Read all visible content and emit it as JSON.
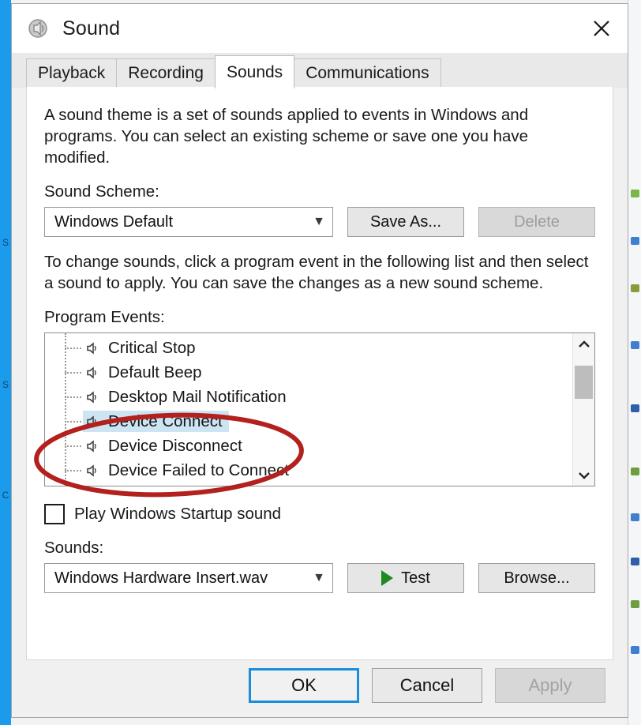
{
  "window": {
    "title": "Sound",
    "icon": "speaker-icon",
    "close_label": "✕"
  },
  "tabs": [
    {
      "label": "Playback",
      "active": false
    },
    {
      "label": "Recording",
      "active": false
    },
    {
      "label": "Sounds",
      "active": true
    },
    {
      "label": "Communications",
      "active": false
    }
  ],
  "sounds_tab": {
    "intro_text": "A sound theme is a set of sounds applied to events in Windows and programs.  You can select an existing scheme or save one you have modified.",
    "scheme_label": "Sound Scheme:",
    "scheme_value": "Windows Default",
    "save_as_label": "Save As...",
    "delete_label": "Delete",
    "delete_disabled": true,
    "instructions_text": "To change sounds, click a program event in the following list and then select a sound to apply.  You can save the changes as a new sound scheme.",
    "program_events_label": "Program Events:",
    "events": [
      {
        "label": "Critical Stop",
        "selected": false
      },
      {
        "label": "Default Beep",
        "selected": false
      },
      {
        "label": "Desktop Mail Notification",
        "selected": false
      },
      {
        "label": "Device Connect",
        "selected": true
      },
      {
        "label": "Device Disconnect",
        "selected": false
      },
      {
        "label": "Device Failed to Connect",
        "selected": false
      }
    ],
    "startup_checkbox_label": "Play Windows Startup sound",
    "startup_checkbox_checked": false,
    "sounds_label": "Sounds:",
    "sound_file_value": "Windows Hardware Insert.wav",
    "test_label": "Test",
    "browse_label": "Browse..."
  },
  "footer": {
    "ok_label": "OK",
    "cancel_label": "Cancel",
    "apply_label": "Apply",
    "apply_disabled": true
  },
  "annotation": {
    "type": "red-ellipse",
    "color": "#b3211f",
    "targets": "Device Connect, Device Disconnect"
  },
  "colors": {
    "selection_highlight": "#cde4f2",
    "default_button_focus": "#1a8ddb",
    "play_icon_green": "#1f8a20",
    "annotation_red": "#b3211f",
    "taskbar_blue": "#1b9bec"
  }
}
